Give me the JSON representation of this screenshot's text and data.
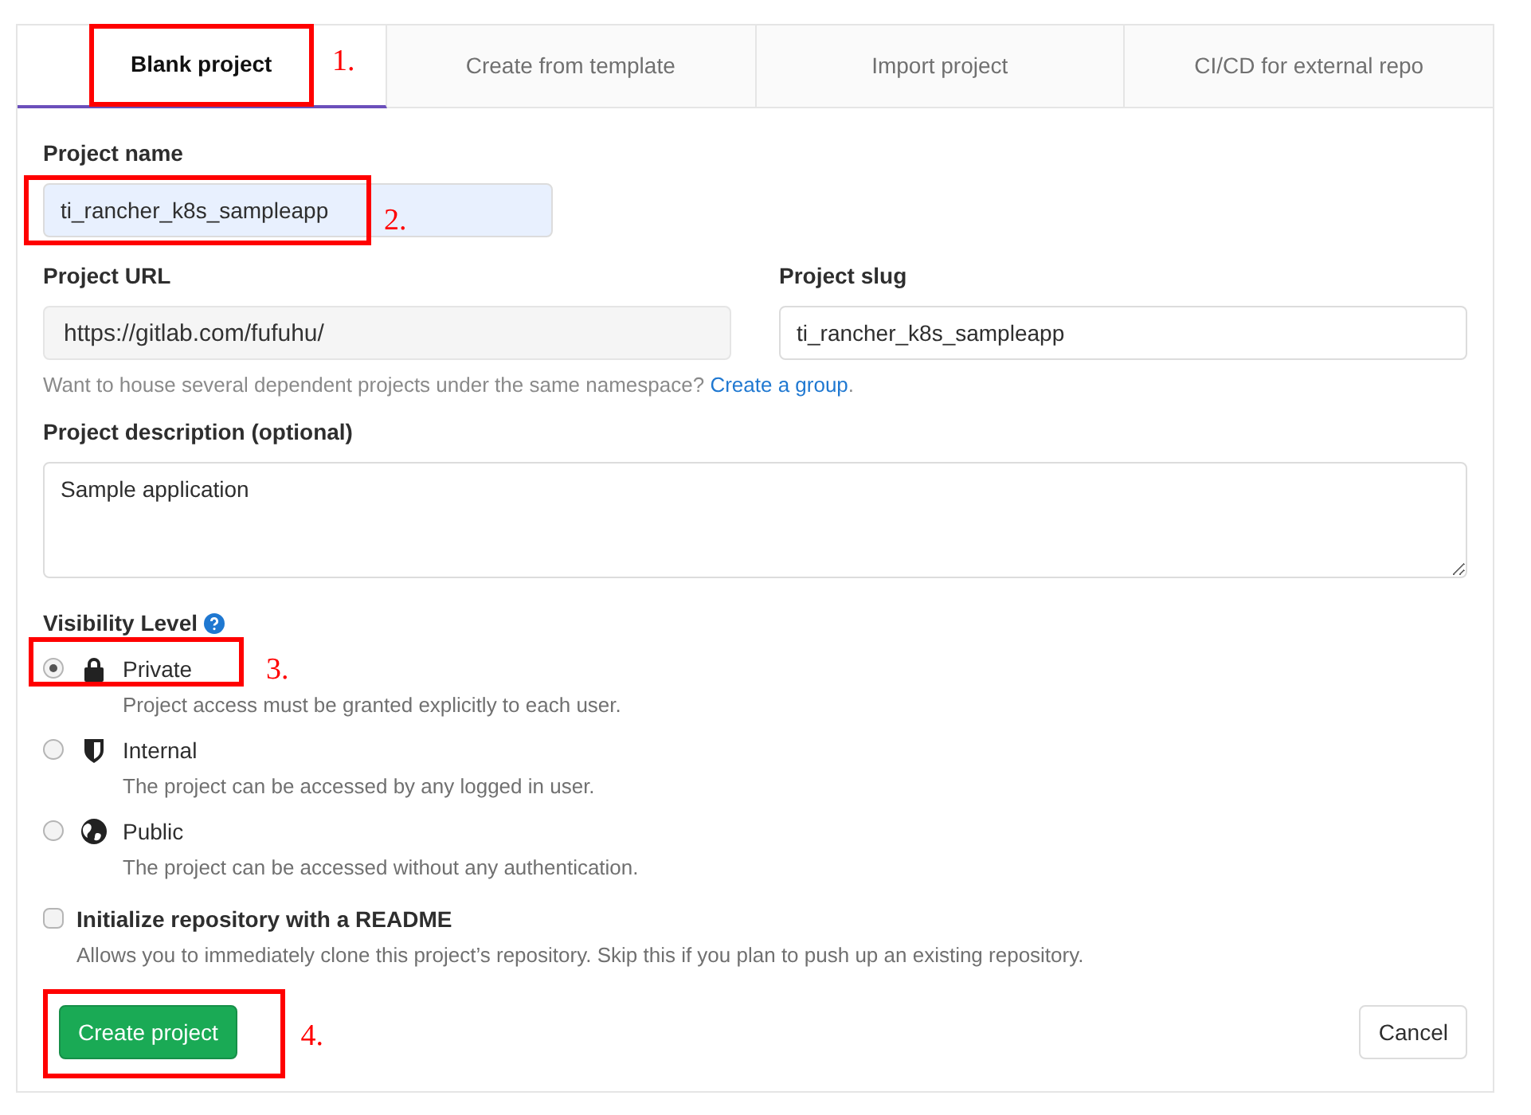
{
  "tabs": [
    {
      "label": "Blank project",
      "selected": true,
      "annotation": "1."
    },
    {
      "label": "Create from template",
      "selected": false
    },
    {
      "label": "Import project",
      "selected": false
    },
    {
      "label": "CI/CD for external repo",
      "selected": false
    }
  ],
  "project_name": {
    "label": "Project name",
    "value": "ti_rancher_k8s_sampleapp",
    "annotation": "2."
  },
  "project_url": {
    "label": "Project URL",
    "value": "https://gitlab.com/fufuhu/"
  },
  "project_slug": {
    "label": "Project slug",
    "value": "ti_rancher_k8s_sampleapp"
  },
  "namespace_hint": {
    "text": "Want to house several dependent projects under the same namespace?",
    "link": "Create a group",
    "suffix": "."
  },
  "description": {
    "label": "Project description (optional)",
    "value": "Sample application"
  },
  "visibility": {
    "label": "Visibility Level",
    "options": [
      {
        "kind": "lock",
        "label": "Private",
        "description": "Project access must be granted explicitly to each user.",
        "selected": true,
        "annotation": "3."
      },
      {
        "kind": "shield",
        "label": "Internal",
        "description": "The project can be accessed by any logged in user.",
        "selected": false
      },
      {
        "kind": "globe",
        "label": "Public",
        "description": "The project can be accessed without any authentication.",
        "selected": false
      }
    ]
  },
  "readme": {
    "label": "Initialize repository with a README",
    "checked": false,
    "description": "Allows you to immediately clone this project’s repository. Skip this if you plan to push up an existing repository."
  },
  "create_button": {
    "label": "Create project",
    "annotation": "4."
  },
  "cancel_button": {
    "label": "Cancel"
  }
}
